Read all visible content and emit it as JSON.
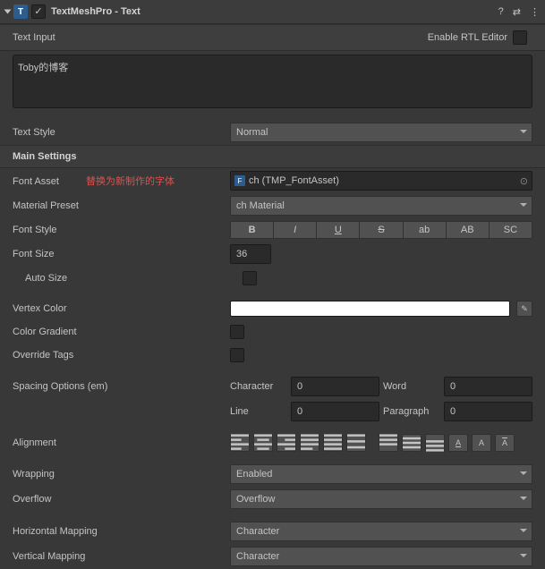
{
  "header": {
    "title": "TextMeshPro - Text",
    "iconLetter": "T"
  },
  "textInput": {
    "label": "Text Input",
    "rtlLabel": "Enable RTL Editor",
    "value": "Toby的博客"
  },
  "textStyle": {
    "label": "Text Style",
    "value": "Normal"
  },
  "mainSettings": "Main Settings",
  "fontAsset": {
    "label": "Font Asset",
    "annotation": "替换为新制作的字体",
    "objIcon": "F",
    "value": "ch (TMP_FontAsset)"
  },
  "materialPreset": {
    "label": "Material Preset",
    "value": "ch Material"
  },
  "fontStyle": {
    "label": "Font Style",
    "b": "B",
    "i": "I",
    "u": "U",
    "s": "S",
    "ab": "ab",
    "AB": "AB",
    "SC": "SC"
  },
  "fontSize": {
    "label": "Font Size",
    "value": "36"
  },
  "autoSize": {
    "label": "Auto Size"
  },
  "vertexColor": {
    "label": "Vertex Color"
  },
  "colorGradient": {
    "label": "Color Gradient"
  },
  "overrideTags": {
    "label": "Override Tags"
  },
  "spacing": {
    "label": "Spacing Options (em)",
    "char": "Character",
    "charV": "0",
    "word": "Word",
    "wordV": "0",
    "line": "Line",
    "lineV": "0",
    "para": "Paragraph",
    "paraV": "0"
  },
  "alignment": {
    "label": "Alignment"
  },
  "wrapping": {
    "label": "Wrapping",
    "value": "Enabled"
  },
  "overflow": {
    "label": "Overflow",
    "value": "Overflow"
  },
  "hMap": {
    "label": "Horizontal Mapping",
    "value": "Character"
  },
  "vMap": {
    "label": "Vertical Mapping",
    "value": "Character"
  }
}
